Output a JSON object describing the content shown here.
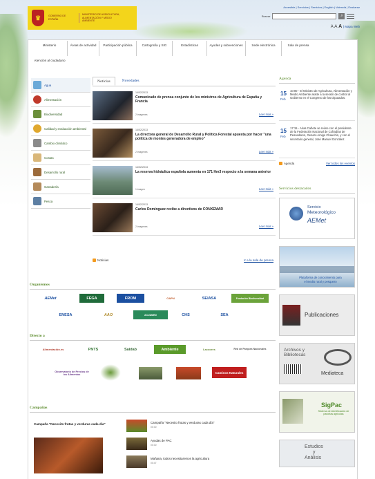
{
  "header": {
    "logo": {
      "line1": "Gobierno de España",
      "line2": "Ministerio de Agricultura, Alimentación y Medio Ambiente"
    },
    "toplinks": "Accesible | Servicios | Servicios | English | Valencià | Euskaraz",
    "search_label": "Buscar",
    "search_placeholder": "",
    "search_button": "⌕",
    "font_small": "A",
    "font_mid": "A",
    "font_big": "A",
    "sitemap_link": "| Mapa Web"
  },
  "topnav": [
    "Ministerio",
    "Áreas de actividad",
    "Participación pública",
    "Cartografía y SIG",
    "Estadísticas",
    "Ayudas y subvenciones",
    "Sede electrónica",
    "Sala de prensa",
    "Atención al ciudadano"
  ],
  "sidebar": [
    {
      "label": "Agua",
      "color": "#6aa9d8"
    },
    {
      "label": "Alimentación",
      "color": "#c0392b"
    },
    {
      "label": "Biodiversidad",
      "color": "#6b8f3a"
    },
    {
      "label": "Calidad y evaluación ambiental",
      "color": "#e0a82e"
    },
    {
      "label": "Cambio climático",
      "color": "#8a8a8a"
    },
    {
      "label": "Costas",
      "color": "#d9b77a"
    },
    {
      "label": "Desarrollo rural",
      "color": "#9c6b3b"
    },
    {
      "label": "Ganadería",
      "color": "#b48a5a"
    },
    {
      "label": "Pesca",
      "color": "#5d7fa3"
    }
  ],
  "news": {
    "tab_active": "Noticias",
    "tab_other": "Novedades",
    "items": [
      {
        "date": "14/02/2013",
        "title": "Comunicado de prensa conjunto de los ministros de Agricultura de España y Francia",
        "images": "2 imagenes",
        "more": "Leer más »"
      },
      {
        "date": "14/02/2013",
        "title": "La directora general de Desarrollo Rural y Política Forestal apuesta por hacer \"una política de montes generadora de empleo\"",
        "images": "2 imagenes",
        "more": "Leer más »"
      },
      {
        "date": "14/02/2013",
        "title": "La reserva hidráulica española aumenta en 171 Hm3 respecto a la semana anterior",
        "images": "1 imagen",
        "more": "Leer más »"
      },
      {
        "date": "14/02/2013",
        "title": "Carlos Domínguez recibe a directivos de CONXEMAR",
        "images": "2 imagenes",
        "more": "Leer más »"
      }
    ],
    "rss_label": "Noticias",
    "press_link": "Ir a la sala de prensa"
  },
  "agenda": {
    "title": "Agenda",
    "items": [
      {
        "day": "15",
        "month": "Feb",
        "text": "10:00 - El Ministro de Agricultura, Alimentación y Medio Ambiente asiste a la sesión de control al Gobierno en el Congreso de los Diputados."
      },
      {
        "day": "15",
        "month": "Feb",
        "text": "17:15 - Arias Cañete se reúne con el presidente de la Federación Nacional de Cofradías de Pescadores, Genaro Amigo Chauchin, y con el secretario general, José Manuel González."
      }
    ],
    "rss_label": "Agenda",
    "all_link": "Ver todos los eventos"
  },
  "destacados": {
    "title": "Servicios destacados",
    "items": [
      {
        "line1": "Servicio",
        "line2": "Meteorológico",
        "line3": "AEMet"
      },
      {
        "line1": "Plataforma de conocimiento para",
        "line2": "el medio rural y pesquero"
      },
      {
        "line1": "Publicaciones"
      },
      {
        "line1": "Archivos y",
        "line2": "Bibliotecas",
        "line3": "Mediateca"
      },
      {
        "line1": "SigPac",
        "line2": "Sistema de identificación de parcelas agrícolas"
      },
      {
        "line1": "Estudios",
        "line2": "y",
        "line3": "Análisis"
      }
    ]
  },
  "organismos": {
    "title": "Organismos",
    "logos": [
      "AEMet",
      "FEGA",
      "FROM",
      "OAPN",
      "SEIASA",
      "Fundación Biodiversidad",
      "ENESA",
      "AAO",
      "ACUAMED",
      "CHS",
      "SEA"
    ]
  },
  "directo": {
    "title": "Directo a",
    "logos": [
      "Alimentación.es",
      "PNTS",
      "Saidab",
      "Ambiente",
      "Lacoores",
      "Red de Parques Nacionales",
      "Observatorio de Precios de los Alimentos",
      "Caminos Naturales"
    ]
  },
  "campanas": {
    "title": "Campañas",
    "featured": "Campaña \"Necesito frutas y verduras cada día\"",
    "items": [
      {
        "title": "Campaña \"Necesito frutas y verduras cada día\"",
        "date": "00:30"
      },
      {
        "title": "Ayudas de PAC",
        "date": "00:30"
      },
      {
        "title": "Mañana, todos necesitaremos la agricultura",
        "date": "00:47"
      }
    ]
  }
}
